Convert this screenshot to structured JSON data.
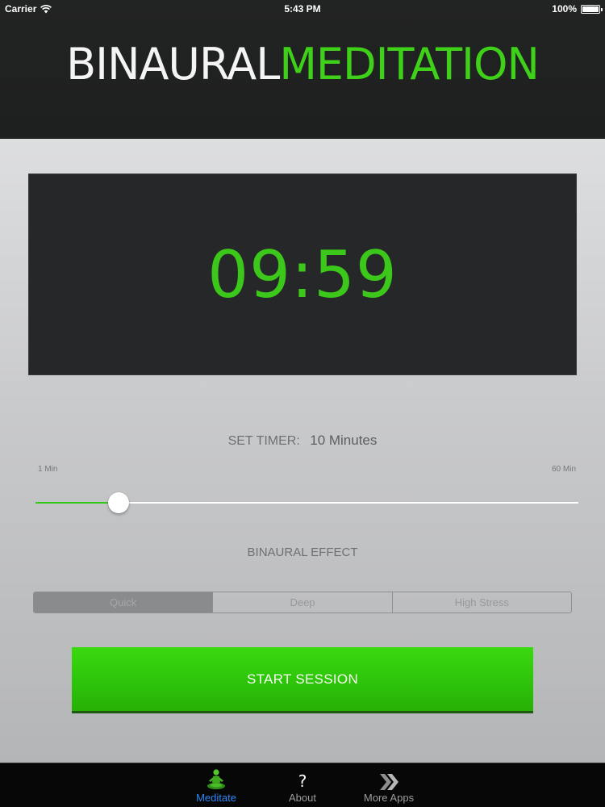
{
  "status_bar": {
    "carrier": "Carrier",
    "time": "5:43 PM",
    "battery": "100%",
    "battery_level": 1.0
  },
  "header": {
    "logo_part1": "BINAURAL",
    "logo_part2": "MEDITATION"
  },
  "timer": {
    "display": "09:59"
  },
  "set_timer": {
    "label": "SET TIMER:",
    "value": "10 Minutes",
    "min_label": "1 Min",
    "max_label": "60 Min",
    "min": 1,
    "max": 60,
    "current": 10
  },
  "binaural_effect": {
    "label": "BINAURAL EFFECT",
    "options": [
      "Quick",
      "Deep",
      "High Stress"
    ],
    "selected": "Quick"
  },
  "start_button": {
    "label": "START SESSION"
  },
  "tab_bar": {
    "tabs": [
      {
        "label": "Meditate",
        "icon": "meditate-icon",
        "active": true
      },
      {
        "label": "About",
        "icon": "question-mark-icon",
        "active": false
      },
      {
        "label": "More Apps",
        "icon": "double-chevron-icon",
        "active": false
      }
    ]
  },
  "colors": {
    "accent_green": "#3cc81a",
    "tab_active_blue": "#2f86f5",
    "header_bg": "#1e1f1f"
  }
}
